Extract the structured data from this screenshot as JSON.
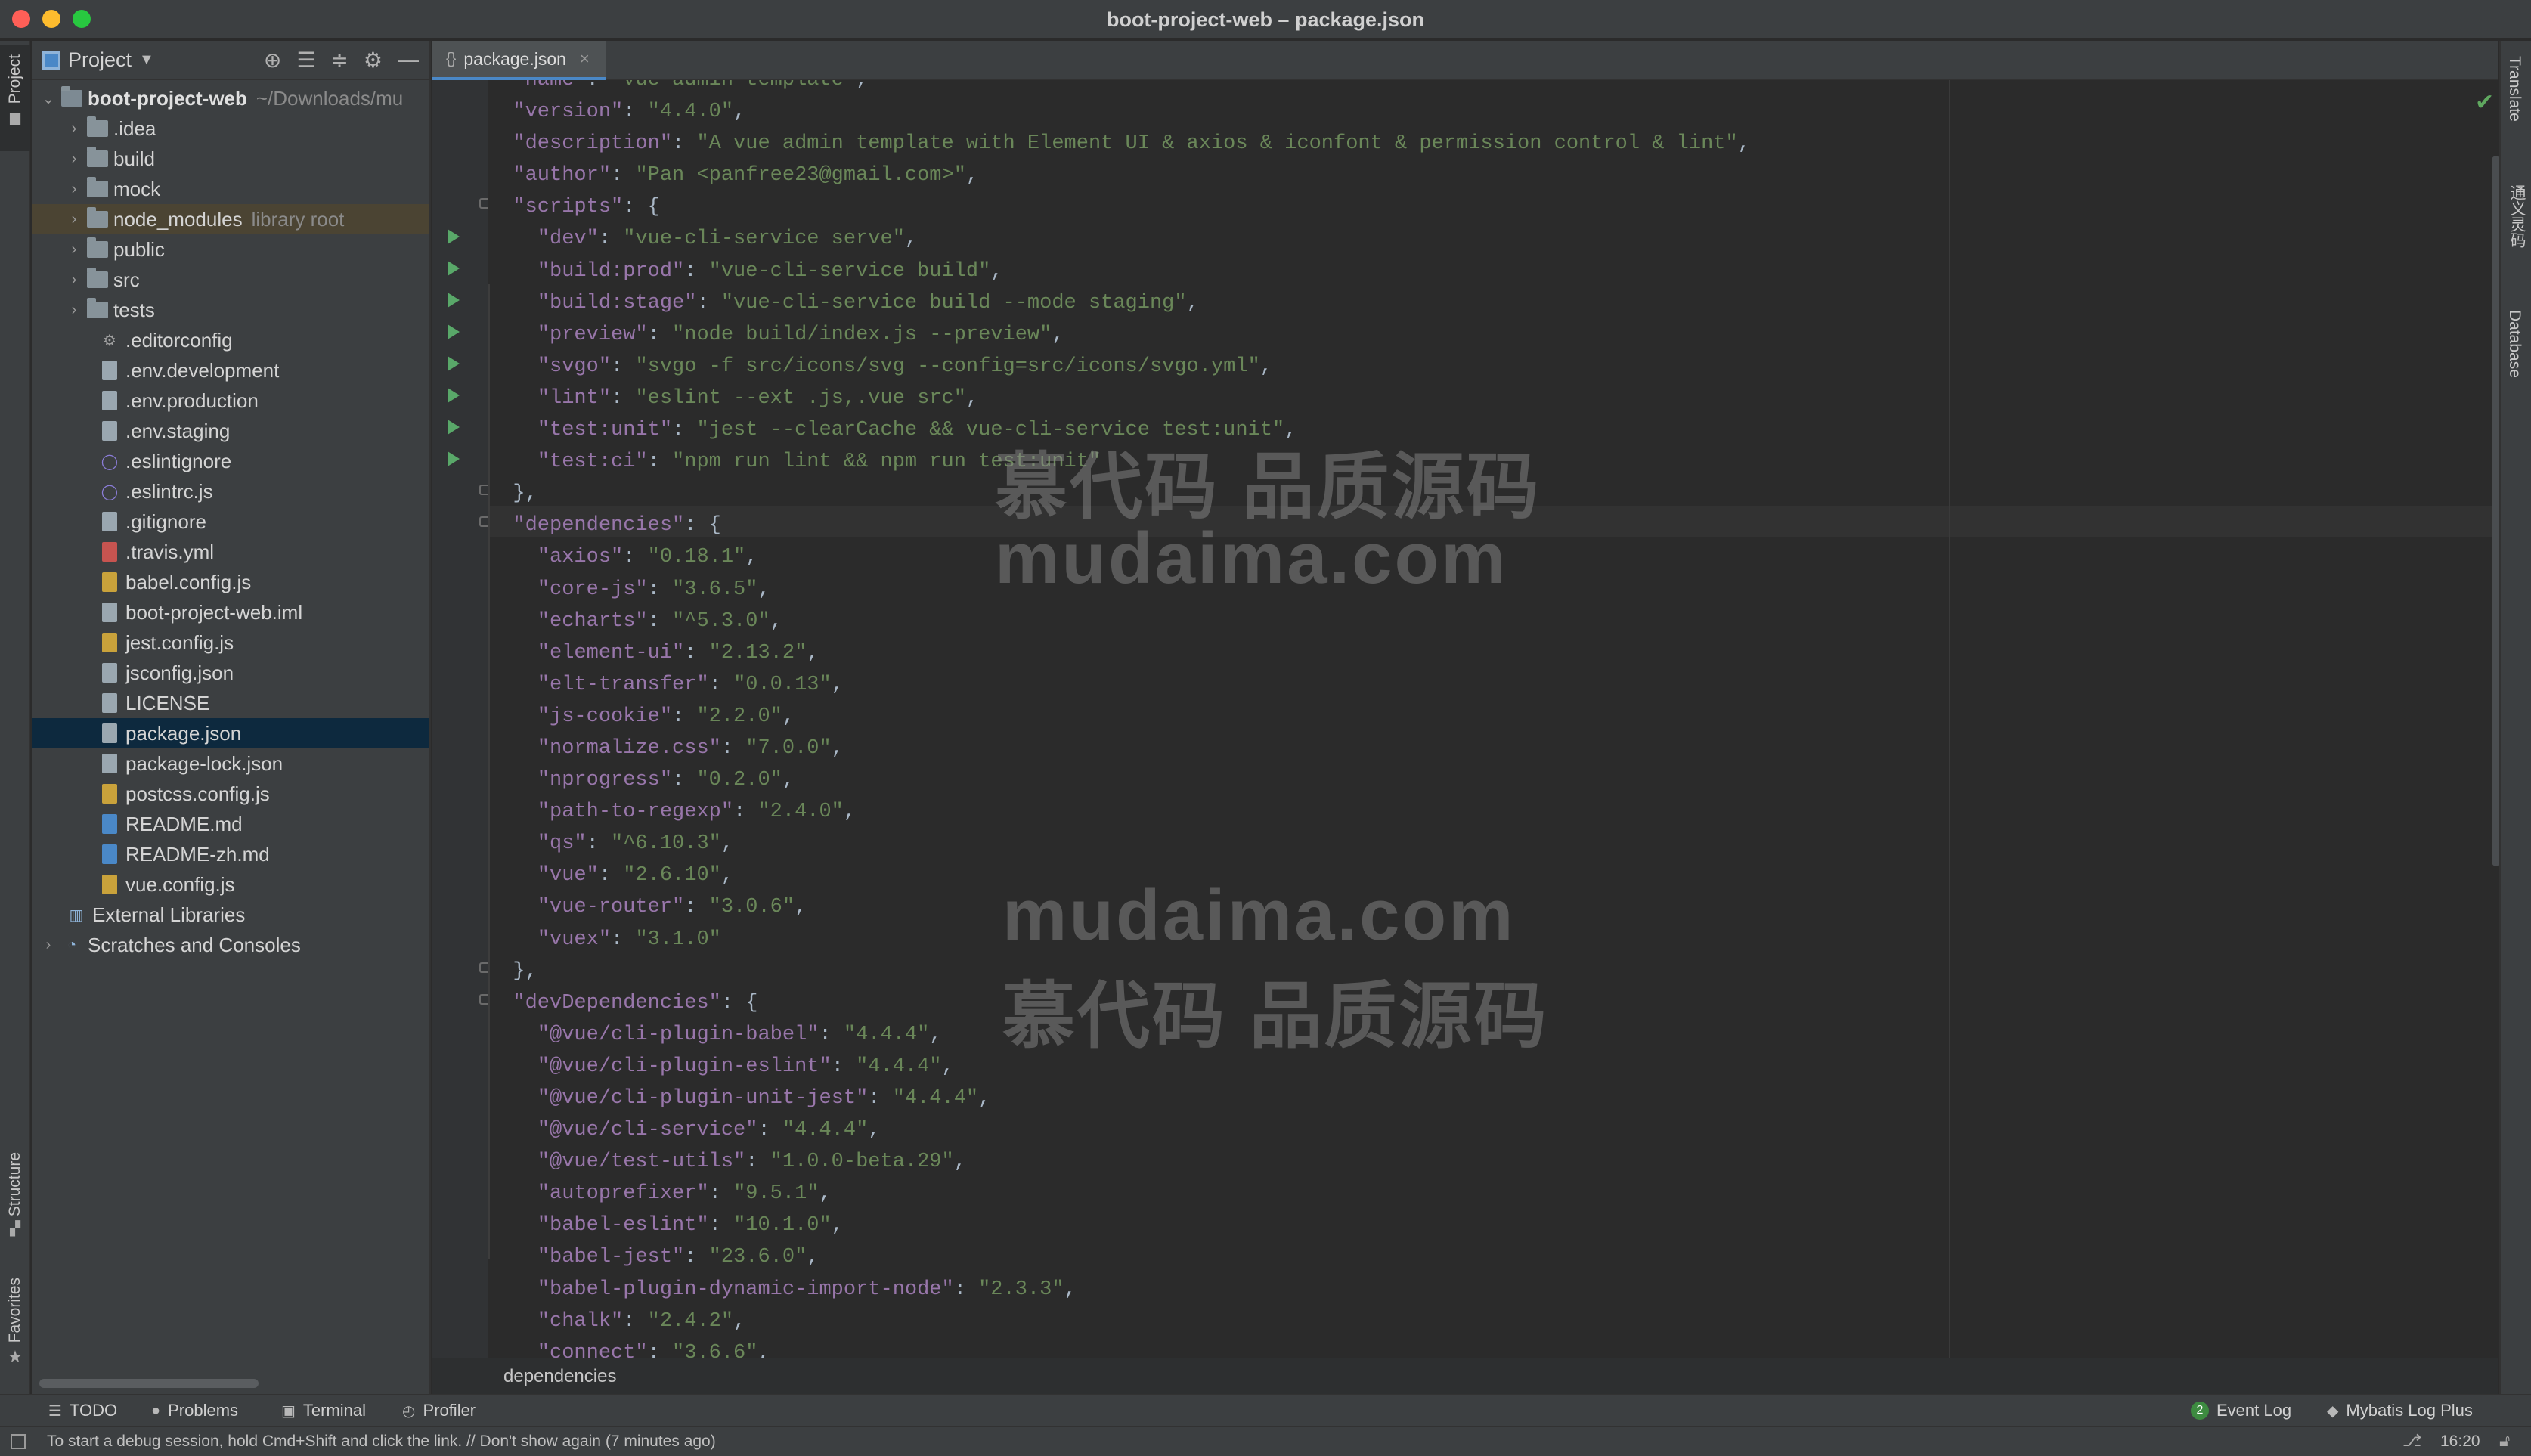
{
  "window": {
    "title": "boot-project-web – package.json"
  },
  "left_strip": {
    "project": "Project",
    "structure": "Structure",
    "favorites": "Favorites"
  },
  "project_panel": {
    "header": "Project",
    "root": {
      "name": "boot-project-web",
      "path": "~/Downloads/mu"
    },
    "items": [
      {
        "name": ".idea",
        "type": "folder"
      },
      {
        "name": "build",
        "type": "folder"
      },
      {
        "name": "mock",
        "type": "folder"
      },
      {
        "name": "node_modules",
        "type": "folder",
        "note": "library root"
      },
      {
        "name": "public",
        "type": "folder"
      },
      {
        "name": "src",
        "type": "folder"
      },
      {
        "name": "tests",
        "type": "folder"
      },
      {
        "name": ".editorconfig",
        "type": "file"
      },
      {
        "name": ".env.development",
        "type": "file"
      },
      {
        "name": ".env.production",
        "type": "file"
      },
      {
        "name": ".env.staging",
        "type": "file"
      },
      {
        "name": ".eslintignore",
        "type": "file"
      },
      {
        "name": ".eslintrc.js",
        "type": "file"
      },
      {
        "name": ".gitignore",
        "type": "file"
      },
      {
        "name": ".travis.yml",
        "type": "file"
      },
      {
        "name": "babel.config.js",
        "type": "file"
      },
      {
        "name": "boot-project-web.iml",
        "type": "file"
      },
      {
        "name": "jest.config.js",
        "type": "file"
      },
      {
        "name": "jsconfig.json",
        "type": "file"
      },
      {
        "name": "LICENSE",
        "type": "file"
      },
      {
        "name": "package.json",
        "type": "file"
      },
      {
        "name": "package-lock.json",
        "type": "file"
      },
      {
        "name": "postcss.config.js",
        "type": "file"
      },
      {
        "name": "README.md",
        "type": "file"
      },
      {
        "name": "README-zh.md",
        "type": "file"
      },
      {
        "name": "vue.config.js",
        "type": "file"
      }
    ],
    "external": "External Libraries",
    "scratches": "Scratches and Consoles"
  },
  "editor": {
    "tab": "package.json",
    "lines": [
      [
        "  ",
        "\"name\"",
        ": ",
        "\"vue-admin-template\"",
        ","
      ],
      [
        "  ",
        "\"version\"",
        ": ",
        "\"4.4.0\"",
        ","
      ],
      [
        "  ",
        "\"description\"",
        ": ",
        "\"A vue admin template with Element UI & axios & iconfont & permission control & lint\"",
        ","
      ],
      [
        "  ",
        "\"author\"",
        ": ",
        "\"Pan <panfree23@gmail.com>\"",
        ","
      ],
      [
        "  ",
        "\"scripts\"",
        ": {",
        "",
        ""
      ],
      [
        "    ",
        "\"dev\"",
        ": ",
        "\"vue-cli-service serve\"",
        ","
      ],
      [
        "    ",
        "\"build:prod\"",
        ": ",
        "\"vue-cli-service build\"",
        ","
      ],
      [
        "    ",
        "\"build:stage\"",
        ": ",
        "\"vue-cli-service build --mode staging\"",
        ","
      ],
      [
        "    ",
        "\"preview\"",
        ": ",
        "\"node build/index.js --preview\"",
        ","
      ],
      [
        "    ",
        "\"svgo\"",
        ": ",
        "\"svgo -f src/icons/svg --config=src/icons/svgo.yml\"",
        ","
      ],
      [
        "    ",
        "\"lint\"",
        ": ",
        "\"eslint --ext .js,.vue src\"",
        ","
      ],
      [
        "    ",
        "\"test:unit\"",
        ": ",
        "\"jest --clearCache && vue-cli-service test:unit\"",
        ","
      ],
      [
        "    ",
        "\"test:ci\"",
        ": ",
        "\"npm run lint && npm run test:unit\"",
        ""
      ],
      [
        "  },",
        "",
        "",
        "",
        ""
      ],
      [
        "  ",
        "\"dependencies\"",
        ": {",
        "",
        ""
      ],
      [
        "    ",
        "\"axios\"",
        ": ",
        "\"0.18.1\"",
        ","
      ],
      [
        "    ",
        "\"core-js\"",
        ": ",
        "\"3.6.5\"",
        ","
      ],
      [
        "    ",
        "\"echarts\"",
        ": ",
        "\"^5.3.0\"",
        ","
      ],
      [
        "    ",
        "\"element-ui\"",
        ": ",
        "\"2.13.2\"",
        ","
      ],
      [
        "    ",
        "\"elt-transfer\"",
        ": ",
        "\"0.0.13\"",
        ","
      ],
      [
        "    ",
        "\"js-cookie\"",
        ": ",
        "\"2.2.0\"",
        ","
      ],
      [
        "    ",
        "\"normalize.css\"",
        ": ",
        "\"7.0.0\"",
        ","
      ],
      [
        "    ",
        "\"nprogress\"",
        ": ",
        "\"0.2.0\"",
        ","
      ],
      [
        "    ",
        "\"path-to-regexp\"",
        ": ",
        "\"2.4.0\"",
        ","
      ],
      [
        "    ",
        "\"qs\"",
        ": ",
        "\"^6.10.3\"",
        ","
      ],
      [
        "    ",
        "\"vue\"",
        ": ",
        "\"2.6.10\"",
        ","
      ],
      [
        "    ",
        "\"vue-router\"",
        ": ",
        "\"3.0.6\"",
        ","
      ],
      [
        "    ",
        "\"vuex\"",
        ": ",
        "\"3.1.0\"",
        ""
      ],
      [
        "  },",
        "",
        "",
        "",
        ""
      ],
      [
        "  ",
        "\"devDependencies\"",
        ": {",
        "",
        ""
      ],
      [
        "    ",
        "\"@vue/cli-plugin-babel\"",
        ": ",
        "\"4.4.4\"",
        ","
      ],
      [
        "    ",
        "\"@vue/cli-plugin-eslint\"",
        ": ",
        "\"4.4.4\"",
        ","
      ],
      [
        "    ",
        "\"@vue/cli-plugin-unit-jest\"",
        ": ",
        "\"4.4.4\"",
        ","
      ],
      [
        "    ",
        "\"@vue/cli-service\"",
        ": ",
        "\"4.4.4\"",
        ","
      ],
      [
        "    ",
        "\"@vue/test-utils\"",
        ": ",
        "\"1.0.0-beta.29\"",
        ","
      ],
      [
        "    ",
        "\"autoprefixer\"",
        ": ",
        "\"9.5.1\"",
        ","
      ],
      [
        "    ",
        "\"babel-eslint\"",
        ": ",
        "\"10.1.0\"",
        ","
      ],
      [
        "    ",
        "\"babel-jest\"",
        ": ",
        "\"23.6.0\"",
        ","
      ],
      [
        "    ",
        "\"babel-plugin-dynamic-import-node\"",
        ": ",
        "\"2.3.3\"",
        ","
      ],
      [
        "    ",
        "\"chalk\"",
        ": ",
        "\"2.4.2\"",
        ","
      ],
      [
        "    ",
        "\"connect\"",
        ": ",
        "\"3.6.6\"",
        ","
      ]
    ],
    "breadcrumb": "dependencies"
  },
  "watermark": {
    "line1": "慕代码 品质源码",
    "line2": "mudaima.com",
    "line3": "mudaima.com",
    "line4": "慕代码 品质源码"
  },
  "right_strip": {
    "translate": "Translate",
    "docs": "通义灵码",
    "database": "Database"
  },
  "toolbar": {
    "todo": "TODO",
    "problems": "Problems",
    "terminal": "Terminal",
    "profiler": "Profiler",
    "event_count": "2",
    "event_log": "Event Log",
    "mybatis": "Mybatis Log Plus"
  },
  "status": {
    "message": "To start a debug session, hold Cmd+Shift and click the link. // Don't show again (7 minutes ago)",
    "time": "16:20"
  }
}
